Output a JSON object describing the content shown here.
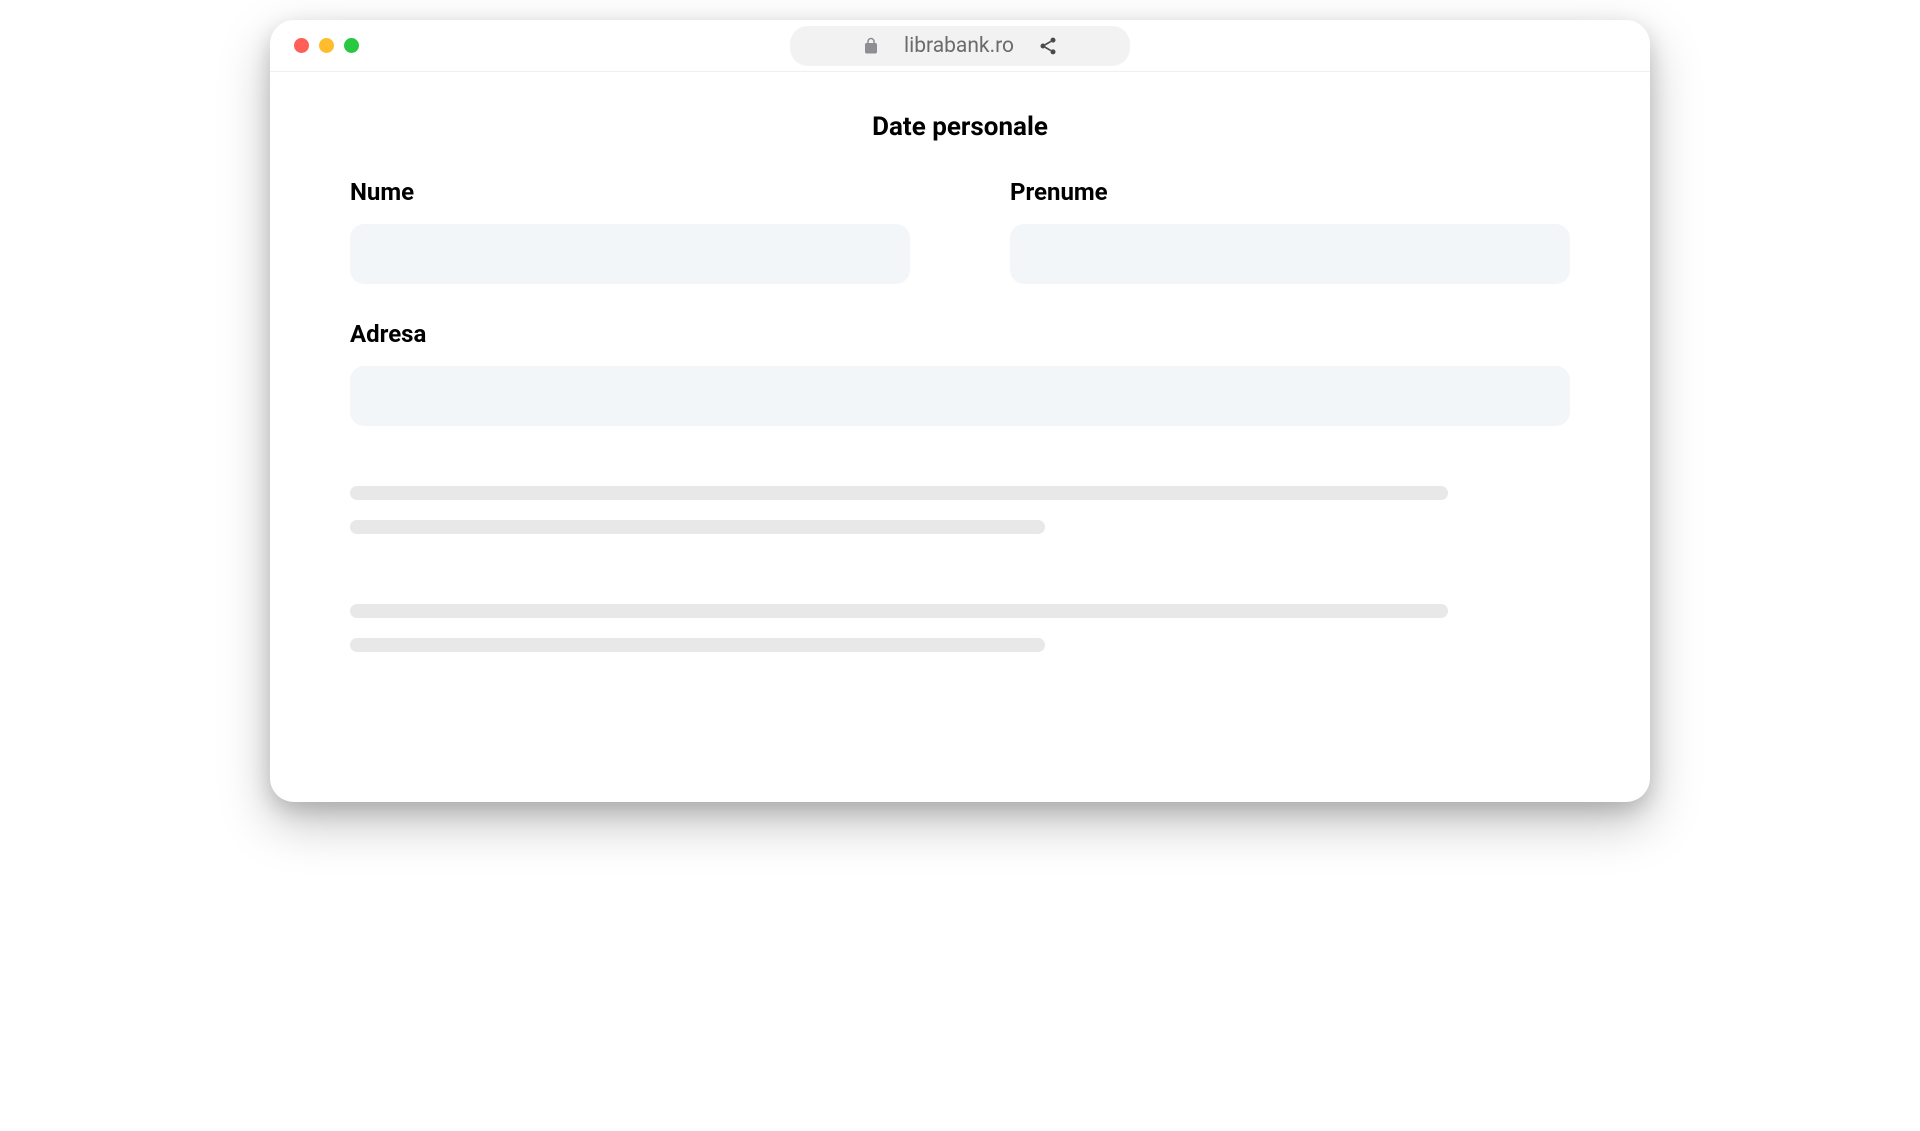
{
  "browser": {
    "url": "librabank.ro"
  },
  "page": {
    "title": "Date personale"
  },
  "form": {
    "fields": {
      "nume": {
        "label": "Nume",
        "value": ""
      },
      "prenume": {
        "label": "Prenume",
        "value": ""
      },
      "adresa": {
        "label": "Adresa",
        "value": ""
      }
    }
  }
}
